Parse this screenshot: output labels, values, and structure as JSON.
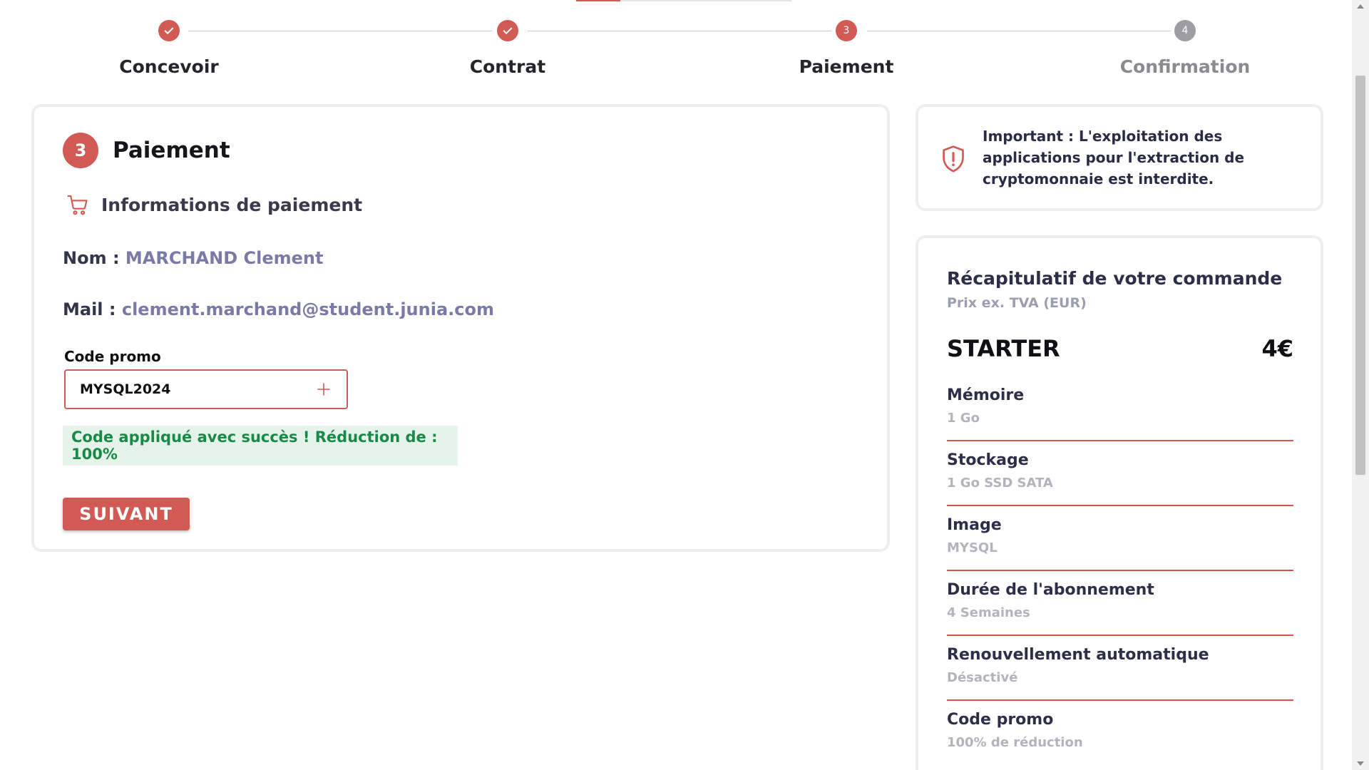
{
  "colors": {
    "accent": "#d15a55",
    "pending": "#9d9da3",
    "success_bg": "#e6f3ea",
    "success_text": "#168a46",
    "link": "#7a7aa6"
  },
  "stepper": {
    "steps": [
      {
        "label": "Concevoir",
        "state": "done",
        "icon": "check-icon"
      },
      {
        "label": "Contrat",
        "state": "done",
        "icon": "check-icon"
      },
      {
        "label": "Paiement",
        "state": "active",
        "number": "3"
      },
      {
        "label": "Confirmation",
        "state": "pending",
        "number": "4"
      }
    ]
  },
  "payment": {
    "step_number": "3",
    "title": "Paiement",
    "section_icon": "cart-icon",
    "section_title": "Informations de paiement",
    "name_label": "Nom :",
    "name_value": "MARCHAND Clement",
    "mail_label": "Mail :",
    "mail_value": "clement.marchand@student.junia.com",
    "promo_label": "Code promo",
    "promo_value": "MYSQL2024",
    "promo_add_icon": "plus-icon",
    "success_message": "Code appliqué avec succès ! Réduction de : 100%",
    "next_button": "SUIVANT"
  },
  "notice": {
    "icon": "shield-alert-icon",
    "text": "Important : L'exploitation des applications pour l'extraction de cryptomonnaie est interdite."
  },
  "summary": {
    "title": "Récapitulatif de votre commande",
    "subtitle": "Prix ex. TVA (EUR)",
    "plan_name": "STARTER",
    "plan_price": "4€",
    "items": [
      {
        "label": "Mémoire",
        "value": "1 Go"
      },
      {
        "label": "Stockage",
        "value": "1 Go SSD SATA"
      },
      {
        "label": "Image",
        "value": "MYSQL"
      },
      {
        "label": "Durée de l'abonnement",
        "value": "4 Semaines"
      },
      {
        "label": "Renouvellement automatique",
        "value": "Désactivé"
      },
      {
        "label": "Code promo",
        "value": "100% de réduction"
      }
    ]
  }
}
